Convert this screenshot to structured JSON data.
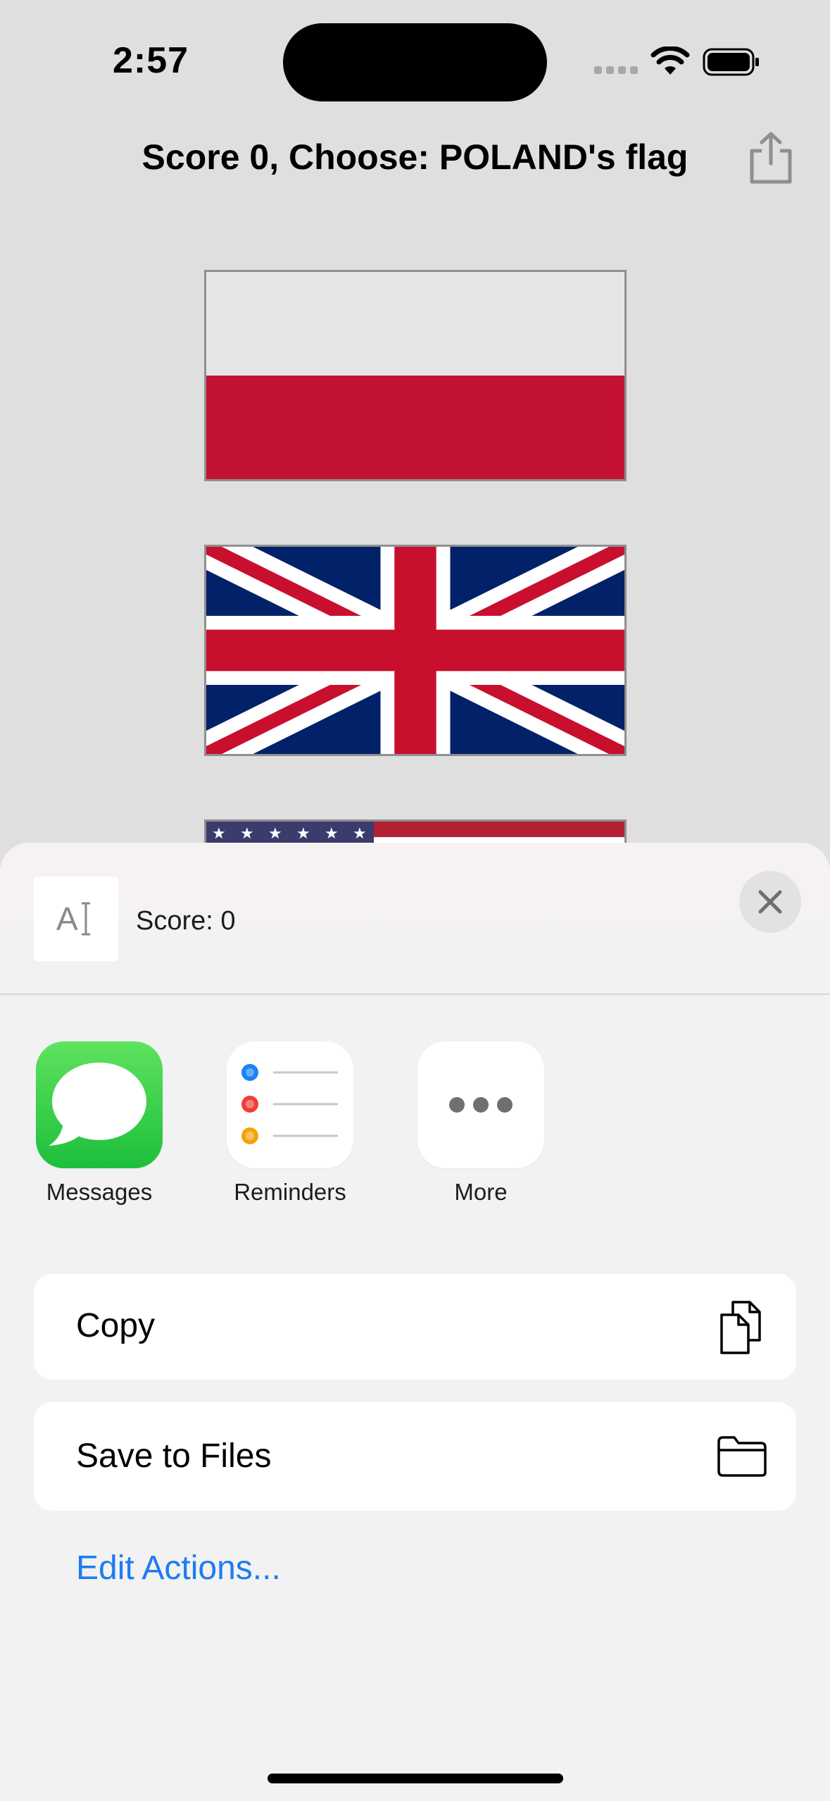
{
  "status_bar": {
    "time": "2:57"
  },
  "nav": {
    "title": "Score 0, Choose: POLAND's flag",
    "share_icon": "share-icon"
  },
  "flags": [
    "poland",
    "united-kingdom",
    "united-states"
  ],
  "share_sheet": {
    "preview_title": "Score: 0",
    "preview_icon": "text-document-icon",
    "apps": [
      {
        "label": "Messages",
        "icon": "messages-icon",
        "color": "#2bcc4a"
      },
      {
        "label": "Reminders",
        "icon": "reminders-icon",
        "color": "#ffffff"
      },
      {
        "label": "More",
        "icon": "more-icon",
        "color": "#ffffff"
      }
    ],
    "actions": [
      {
        "label": "Copy",
        "icon": "copy-icon"
      },
      {
        "label": "Save to Files",
        "icon": "folder-icon"
      }
    ],
    "edit_actions_label": "Edit Actions...",
    "link_color": "#1e7cf0"
  }
}
